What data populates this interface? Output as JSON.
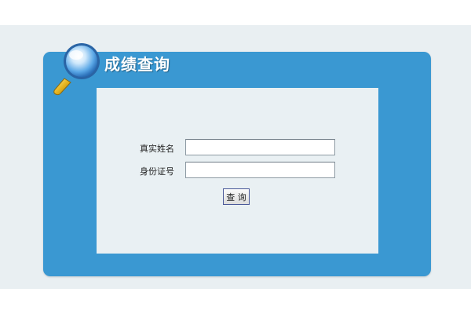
{
  "panel": {
    "title": "成绩查询",
    "icon": "magnifier-icon"
  },
  "form": {
    "name_label": "真实姓名",
    "name_value": "",
    "id_label": "身份证号",
    "id_value": "",
    "query_button": "查 询"
  },
  "colors": {
    "panel_blue": "#3a98d2",
    "background": "#e9eff2",
    "form_background": "#e9f0f3"
  }
}
